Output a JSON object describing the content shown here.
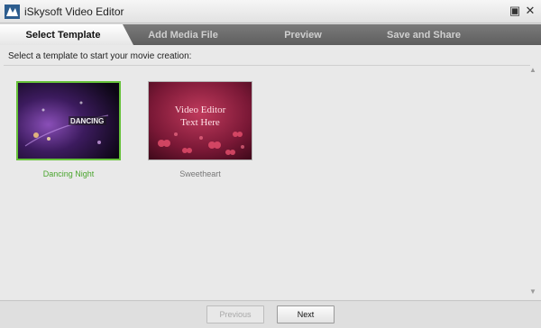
{
  "app": {
    "title": "iSkysoft Video Editor",
    "icon": "app-logo-icon"
  },
  "window_buttons": [
    {
      "name": "restore-icon",
      "glyph": "▣"
    },
    {
      "name": "close-icon",
      "glyph": "✕"
    }
  ],
  "tabs": [
    {
      "label": "Select Template",
      "active": true
    },
    {
      "label": "Add Media File",
      "active": false
    },
    {
      "label": "Preview",
      "active": false
    },
    {
      "label": "Save and Share",
      "active": false
    }
  ],
  "main": {
    "instruction": "Select a template to start your movie creation:",
    "templates": [
      {
        "name": "Dancing Night",
        "thumb_text": "DANCING",
        "selected": true
      },
      {
        "name": "Sweetheart",
        "thumb_text_line1": "Video Editor",
        "thumb_text_line2": "Text Here",
        "selected": false
      }
    ]
  },
  "footer": {
    "previous_label": "Previous",
    "next_label": "Next"
  },
  "colors": {
    "selected_accent": "#67c23a",
    "tab_bar": "#6a6a6a"
  }
}
